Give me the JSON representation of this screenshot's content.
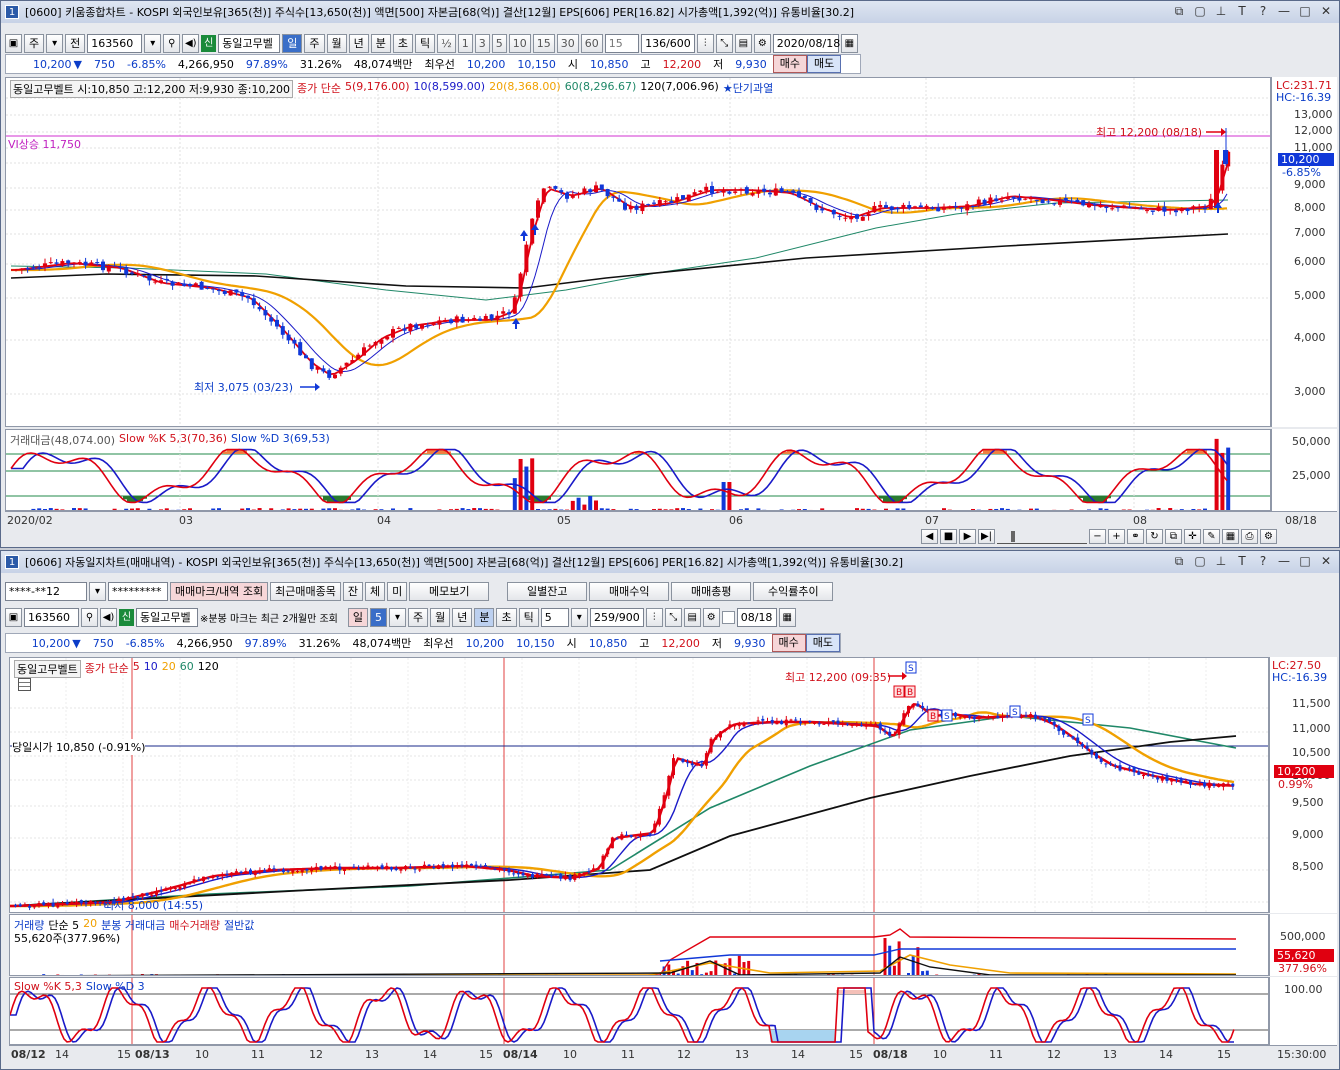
{
  "colors": {
    "up": "#e00010",
    "down": "#1038d8",
    "ma5": "#e00010",
    "ma10": "#1a1ac8",
    "ma20": "#f0a000",
    "ma60": "#208868",
    "ma120": "#101010"
  },
  "top": {
    "title": "[0600] 키움종합차트 - KOSPI 외국인보유[365(천)] 주식수[13,650(천)] 액면[500] 자본금[68(억)] 결산[12월] EPS[606] PER[16.82] 시가총액[1,392(억)] 유통비율[30.2]",
    "winnum": "1",
    "ctrl_icons": [
      "restore-icon",
      "maximize-small-icon",
      "pin-icon",
      "font-icon",
      "help-icon",
      "minimize-icon",
      "maximize-icon",
      "close-icon"
    ],
    "toolbar": {
      "market": "주",
      "prev": "전",
      "code": "163560",
      "stock_name": "동일고무벨",
      "periods": [
        "일",
        "주",
        "월",
        "년",
        "분",
        "초",
        "틱"
      ],
      "selected_period": "일",
      "half": "½",
      "intervals": [
        "1",
        "3",
        "5",
        "10",
        "15",
        "30",
        "60"
      ],
      "interval_combo": "15",
      "count": "136/600",
      "date": "2020/08/18",
      "new_badge": "신"
    },
    "quote": {
      "price": "10,200",
      "arrow": "▼",
      "change": "750",
      "pct": "-6.85%",
      "volume": "4,266,950",
      "ratio": "97.89%",
      "turnover": "31.26%",
      "amount": "48,074백만",
      "best_label": "최우선",
      "best_ask": "10,200",
      "best_bid": "10,150",
      "open_label": "시",
      "open": "10,850",
      "high_label": "고",
      "high": "12,200",
      "low_label": "저",
      "low": "9,930",
      "buy": "매수",
      "sell": "매도"
    },
    "price_legend": {
      "name": "동일고무벨트 시:10,850 고:12,200 저:9,930 종:10,200",
      "ma_label": "종가 단순",
      "ma5": "5(9,176.00)",
      "ma10": "10(8,599.00)",
      "ma20": "20(8,368.00)",
      "ma60": "60(8,296.67)",
      "ma120": "120(7,006.96)",
      "overheat": "★단기과열"
    },
    "upper_limit": "VI상승 11,750",
    "high_mark": "최고 12,200 (08/18)",
    "low_mark": "최저 3,075 (03/23)",
    "lc": "LC:231.71",
    "hc": "HC:-16.39",
    "y_ticks": [
      "13,000",
      "12,000",
      "11,000",
      "10,000",
      "9,000",
      "8,000",
      "7,000",
      "6,000",
      "5,000",
      "4,000",
      "3,000"
    ],
    "price_tag": "10,200",
    "price_tag_pct": "-6.85%",
    "vol_legend": {
      "amount": "거래대금(48,074.00)",
      "slowk": "Slow %K 5,3(70,36)",
      "slowd": "Slow %D 3(69,53)"
    },
    "vol_ticks": [
      "50,000",
      "25,000"
    ],
    "x_ticks": [
      "2020/02",
      "03",
      "04",
      "05",
      "06",
      "07",
      "08"
    ],
    "x_end": "08/18"
  },
  "bottom": {
    "title": "[0606] 자동일지차트(매매내역) - KOSPI 외국인보유[365(천)] 주식수[13,650(천)] 액면[500] 자본금[68(억)] 결산[12월] EPS[606] PER[16.82] 시가총액[1,392(억)] 유통비율[30.2]",
    "winnum": "1",
    "account": "****-**12",
    "password": "*********",
    "tabs": [
      "매매마크/내역 조회",
      "최근매매종목",
      "잔",
      "체",
      "미",
      "메모보기",
      "일별잔고",
      "매매수익",
      "매매총평",
      "수익률추이"
    ],
    "toolbar": {
      "code": "163560",
      "stock_name": "동일고무벨",
      "note": "※분봉 마크는 최근 2개월만 조회",
      "periods": [
        "일",
        "5",
        "주",
        "월",
        "년",
        "분",
        "초",
        "틱"
      ],
      "interval": "5",
      "count": "259/900",
      "date": "08/18",
      "new_badge": "신"
    },
    "quote": {
      "price": "10,200",
      "arrow": "▼",
      "change": "750",
      "pct": "-6.85%",
      "volume": "4,266,950",
      "ratio": "97.89%",
      "turnover": "31.26%",
      "amount": "48,074백만",
      "best_label": "최우선",
      "best_ask": "10,200",
      "best_bid": "10,150",
      "open_label": "시",
      "open": "10,850",
      "high_label": "고",
      "high": "12,200",
      "low_label": "저",
      "low": "9,930",
      "buy": "매수",
      "sell": "매도"
    },
    "price_legend": {
      "name": "동일고무벨트",
      "ma_label": "종가 단순",
      "ma5": "5",
      "ma10": "10",
      "ma20": "20",
      "ma60": "60",
      "ma120": "120"
    },
    "open_line": "당일시가 10,850 (-0.91%)",
    "high_mark": "최고 12,200 (09:35)",
    "low_mark": "최저 8,000 (14:55)",
    "lc": "LC:27.50",
    "hc": "HC:-16.39",
    "y_ticks": [
      "11,500",
      "11,000",
      "10,500",
      "10,000",
      "9,500",
      "9,000",
      "8,500"
    ],
    "price_tag": "10,200",
    "price_tag_pct": "0.99%",
    "vol_legend": {
      "vol": "거래량",
      "ma": "단순 5",
      "ma2": "20",
      "amount": "분봉 거래대금",
      "buyvol": "매수거래량",
      "half": "절반값",
      "sub": "55,620주(377.96%)"
    },
    "vol_ticks": [
      "500,000"
    ],
    "vol_tag": "55,620",
    "vol_tag_pct": "377.96%",
    "stoch_legend": {
      "k": "Slow %K 5,3",
      "d": "Slow %D 3"
    },
    "stoch_ticks": [
      "100.00"
    ],
    "x_ticks": [
      "08/12",
      "14",
      "15",
      "08/13",
      "10",
      "11",
      "12",
      "13",
      "14",
      "15",
      "08/14",
      "10",
      "11",
      "12",
      "13",
      "14",
      "15",
      "08/18",
      "10",
      "11",
      "12",
      "13",
      "14",
      "15"
    ],
    "x_end": "15:30:00",
    "marks": [
      "S",
      "B",
      "B",
      "B",
      "S",
      "S",
      "S"
    ]
  }
}
